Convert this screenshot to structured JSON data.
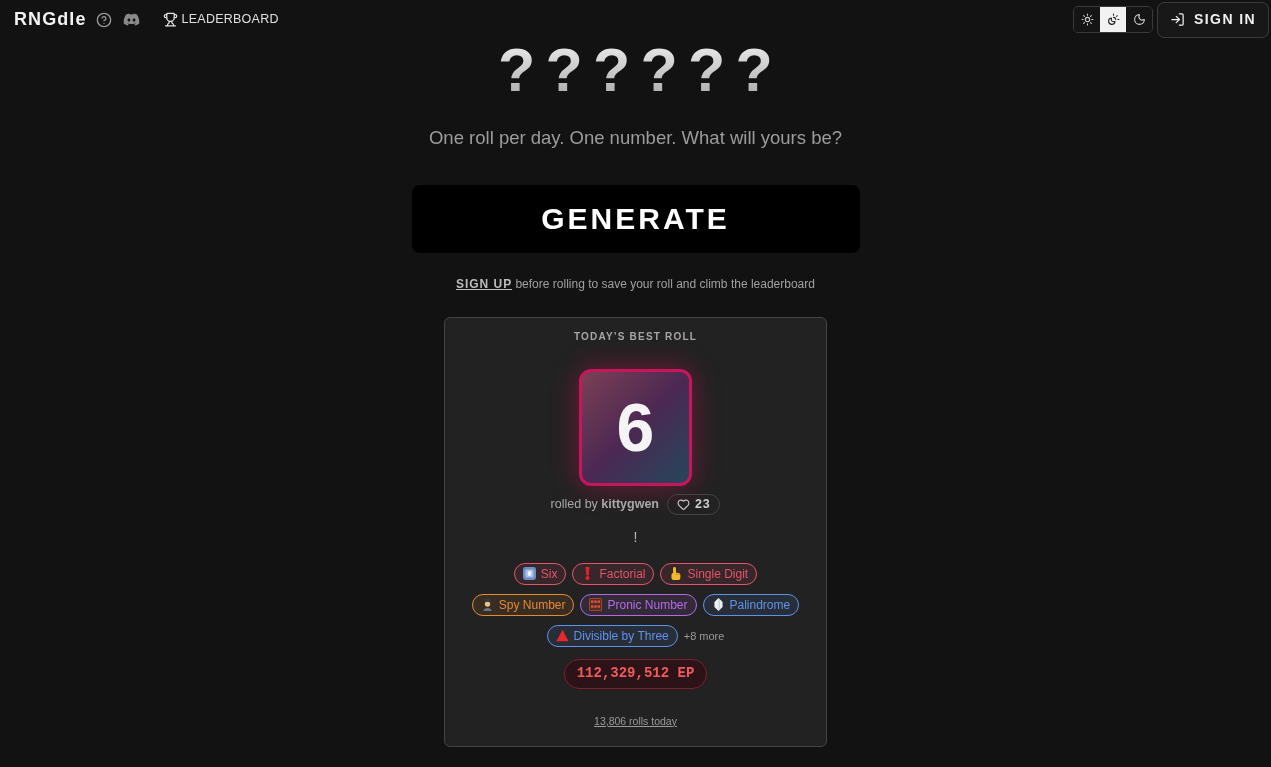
{
  "header": {
    "logo": "RNGdle",
    "leaderboard_link": "LEADERBOARD",
    "theme_options": [
      {
        "kind": "light",
        "selected": false
      },
      {
        "kind": "system",
        "selected": true
      },
      {
        "kind": "dark",
        "selected": false
      }
    ],
    "sign_in": "SIGN IN"
  },
  "hero": {
    "slots": [
      "?",
      "?",
      "?",
      "?",
      "?",
      "?"
    ],
    "tagline": "One roll per day. One number. What will yours be?",
    "generate_button": "GENERATE",
    "signup_prompt": {
      "link": "SIGN UP",
      "text": "before rolling to save your roll and climb the leaderboard"
    }
  },
  "best_roll": {
    "title": "TODAY’S BEST ROLL",
    "number": "6",
    "rolled_by": "rolled by **kittygwen**",
    "likes": "23",
    "caption": "!",
    "tags": [
      {
        "kind": "keycap",
        "label": "Six",
        "color": "#e2546a"
      },
      {
        "kind": "exclamation",
        "label": "Factorial",
        "color": "#e2546a"
      },
      {
        "kind": "pointer",
        "label": "Single Digit",
        "color": "#e2546a"
      },
      {
        "kind": "detective",
        "label": "Spy Number",
        "color": "#e8892f"
      },
      {
        "kind": "abacus",
        "label": "Pronic Number",
        "color": "#b46ae6"
      },
      {
        "kind": "gem",
        "label": "Palindrome",
        "color": "#5e92ea"
      },
      {
        "kind": "triangle",
        "label": "Divisible by Three",
        "color": "#5e92ea"
      }
    ],
    "more": "+8 more",
    "points": "112,329,512 EP",
    "rolls_today": "13,806 rolls today"
  }
}
